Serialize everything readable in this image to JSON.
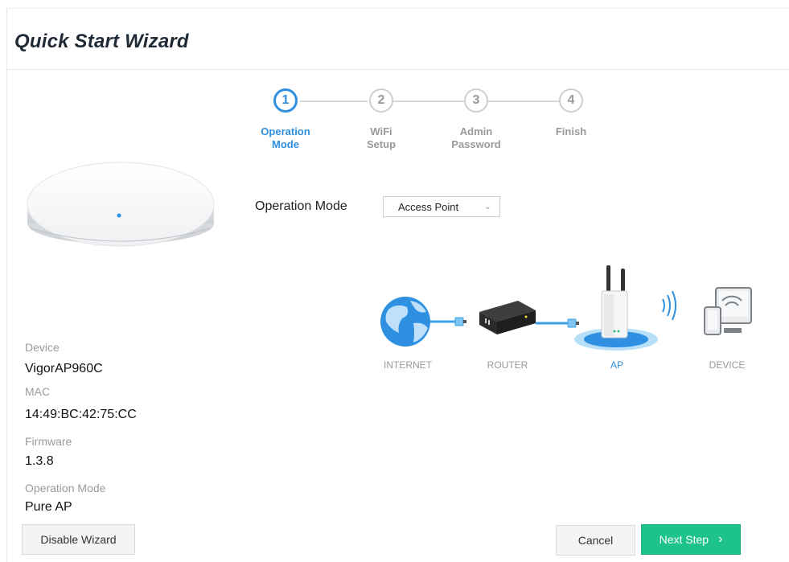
{
  "title": "Quick Start Wizard",
  "steps": [
    {
      "number": "1",
      "label_line1": "Operation",
      "label_line2": "Mode",
      "active": true
    },
    {
      "number": "2",
      "label_line1": "WiFi",
      "label_line2": "Setup",
      "active": false
    },
    {
      "number": "3",
      "label_line1": "Admin",
      "label_line2": "Password",
      "active": false
    },
    {
      "number": "4",
      "label_line1": "Finish",
      "label_line2": "",
      "active": false
    }
  ],
  "device_info": {
    "device_label": "Device",
    "device_value": "VigorAP960C",
    "mac_label": "MAC",
    "mac_value": "14:49:BC:42:75:CC",
    "firmware_label": "Firmware",
    "firmware_value": "1.3.8",
    "opmode_label": "Operation Mode",
    "opmode_value": "Pure AP"
  },
  "form": {
    "operation_mode_label": "Operation Mode",
    "operation_mode_value": "Access Point"
  },
  "topology": {
    "internet": "INTERNET",
    "router": "ROUTER",
    "ap": "AP",
    "device": "DEVICE"
  },
  "buttons": {
    "disable_wizard": "Disable Wizard",
    "cancel": "Cancel",
    "next_step": "Next Step"
  },
  "colors": {
    "accent_blue": "#2f8fe0",
    "next_green": "#1ec28b"
  }
}
